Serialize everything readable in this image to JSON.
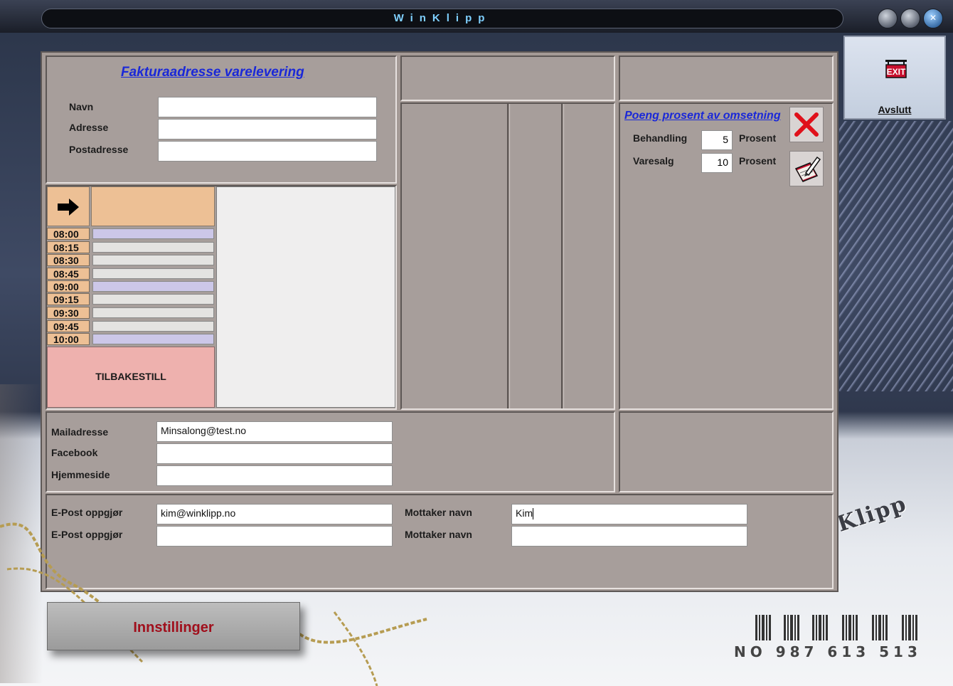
{
  "window": {
    "title": "WinKlipp"
  },
  "exit": {
    "label": "Avslutt",
    "icon": "exit-sign-icon"
  },
  "invoice": {
    "title": "Fakturaadresse varelevering",
    "name_label": "Navn",
    "name_value": "",
    "address_label": "Adresse",
    "address_value": "",
    "postal_label": "Postadresse",
    "postal_value": ""
  },
  "schedule": {
    "arrow_icon": "right-arrow-icon",
    "times": [
      "08:00",
      "08:15",
      "08:30",
      "08:45",
      "09:00",
      "09:15",
      "09:30",
      "09:45",
      "10:00"
    ],
    "reset_label": "TILBAKESTILL"
  },
  "points": {
    "title": "Poeng prosent av omsetning",
    "treatment_label": "Behandling",
    "treatment_value": "5",
    "treatment_unit": "Prosent",
    "sales_label": "Varesalg",
    "sales_value": "10",
    "sales_unit": "Prosent"
  },
  "contact": {
    "mail_label": "Mailadresse",
    "mail_value": "Minsalong@test.no",
    "facebook_label": "Facebook",
    "facebook_value": "",
    "home_label": "Hjemmeside",
    "home_value": ""
  },
  "settlement": {
    "email1_label": "E-Post oppgjør",
    "email1_value": "kim@winklipp.no",
    "email2_label": "E-Post oppgjør",
    "email2_value": "",
    "recipient1_label": "Mottaker navn",
    "recipient1_value": "Kim",
    "recipient2_label": "Mottaker navn",
    "recipient2_value": ""
  },
  "settings_button": {
    "label": "Innstillinger"
  },
  "org_number": "NO 987 613 513",
  "decor_text": "Klipp",
  "colors": {
    "panel": "#a79e9b",
    "link": "#1a28d8",
    "slot_orange": "#edc095",
    "slot_lilac": "#ccc7e8",
    "slot_grey": "#e4e3e1",
    "reset_pink": "#eeb1ae",
    "settings_text": "#a00f1c"
  }
}
